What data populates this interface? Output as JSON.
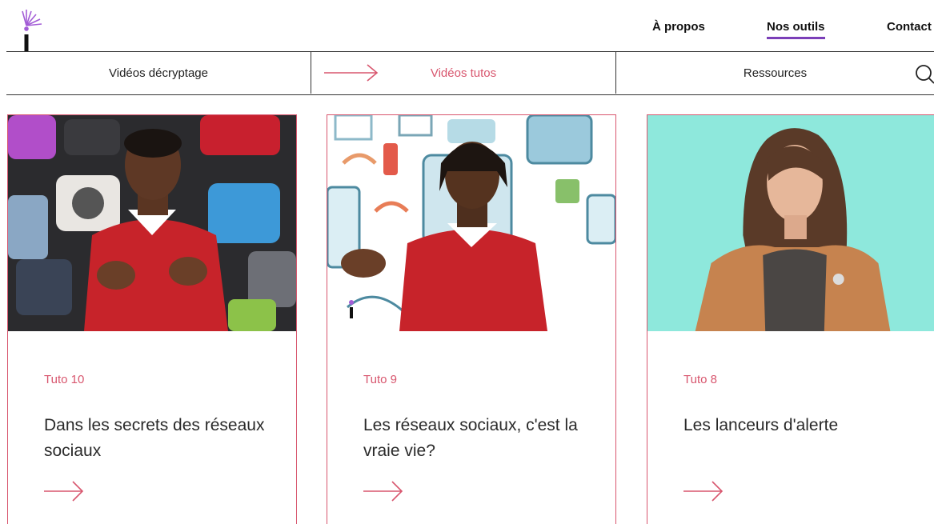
{
  "header": {
    "nav": [
      {
        "label": "À propos"
      },
      {
        "label": "Nos outils"
      },
      {
        "label": "Contact"
      }
    ]
  },
  "subnav": {
    "items": [
      {
        "label": "Vidéos décryptage"
      },
      {
        "label": "Vidéos tutos"
      },
      {
        "label": "Ressources"
      }
    ],
    "active_index": 1
  },
  "cards": [
    {
      "tag": "Tuto 10",
      "title": "Dans les secrets des réseaux sociaux"
    },
    {
      "tag": "Tuto 9",
      "title": "Les réseaux sociaux, c'est la vraie vie?"
    },
    {
      "tag": "Tuto 8",
      "title": "Les lanceurs d'alerte"
    }
  ],
  "colors": {
    "accent": "#d8566e",
    "nav_underline": "#7b3fb8"
  }
}
